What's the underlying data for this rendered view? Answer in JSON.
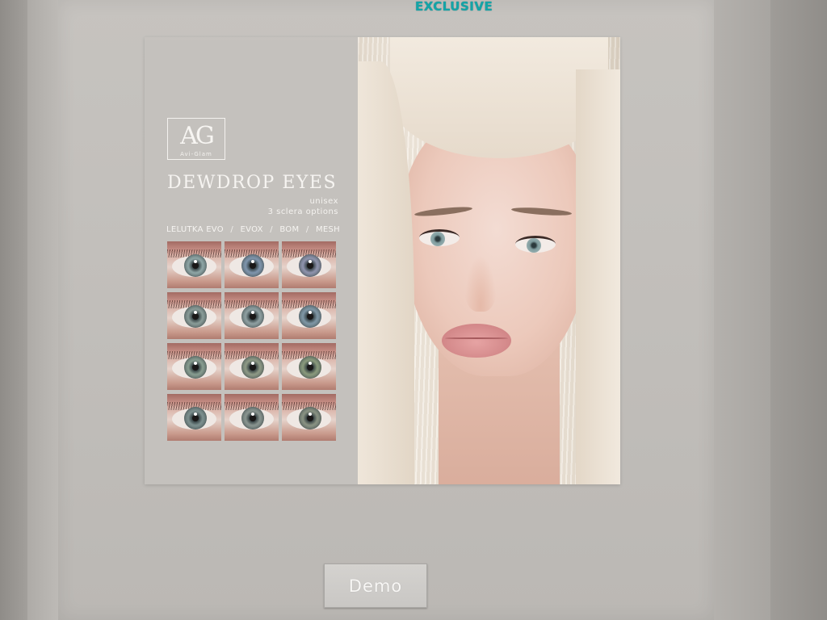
{
  "header": {
    "exclusive_label": "EXCLUSIVE"
  },
  "poster": {
    "logo": {
      "mark": "AG",
      "brand": "Avi-Glam"
    },
    "title": "DEWDROP EYES",
    "subtitle_1": "unisex",
    "subtitle_2": "3 sclera options",
    "compat": [
      "LELUTKA EVO",
      "EVOX",
      "BOM",
      "MESH"
    ],
    "compat_separator": "/",
    "swatches": [
      {
        "iris": "#8fa6a6"
      },
      {
        "iris": "#7f95ad"
      },
      {
        "iris": "#8f94ae"
      },
      {
        "iris": "#8a9c98"
      },
      {
        "iris": "#8fa0a2"
      },
      {
        "iris": "#7f97a6"
      },
      {
        "iris": "#889d90"
      },
      {
        "iris": "#8f9a86"
      },
      {
        "iris": "#8a9a7c"
      },
      {
        "iris": "#7d908f"
      },
      {
        "iris": "#8a9590"
      },
      {
        "iris": "#8a9383"
      }
    ]
  },
  "demo_button": {
    "label": "Demo"
  },
  "colors": {
    "exclusive_accent": "#13a5a8",
    "board": "#c4c1bd",
    "text_light": "#f6f4f1"
  }
}
